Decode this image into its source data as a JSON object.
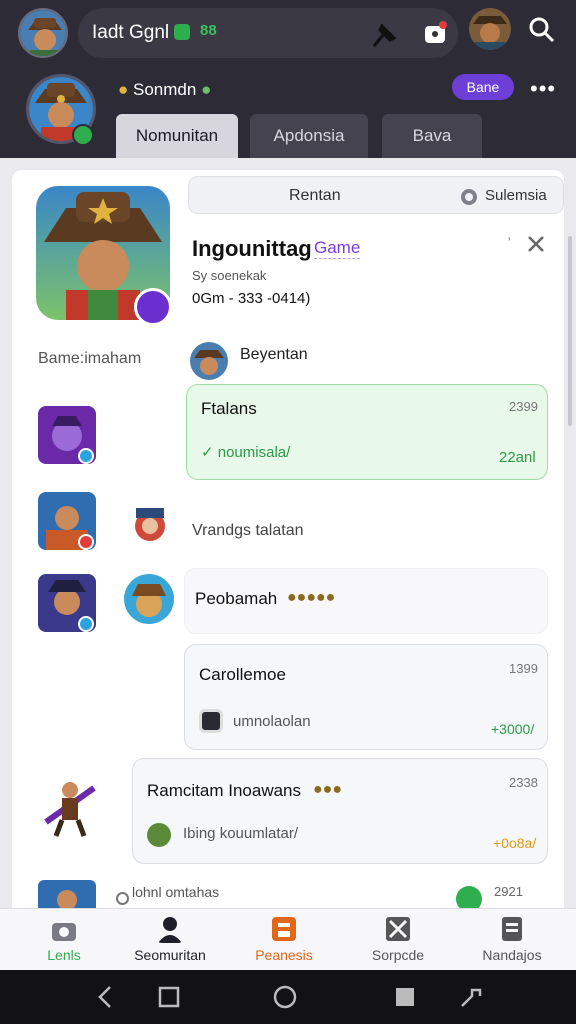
{
  "topbar": {
    "title": "Iadt Ggnl",
    "green_text": "88",
    "icons": [
      "avatar",
      "pin-icon",
      "gift-icon",
      "avatar",
      "search-icon"
    ]
  },
  "profile": {
    "name": "Sonmdn",
    "badge_label": "Bane",
    "more_label": "•••"
  },
  "tabs": [
    {
      "label": "Nomunitan",
      "active": true
    },
    {
      "label": "Apdonsia",
      "active": false
    },
    {
      "label": "Bava",
      "active": false
    }
  ],
  "filter": {
    "label": "Rentan",
    "right_label": "Sulemsia"
  },
  "game": {
    "title": "Ingounittag",
    "tag": "Game",
    "subtitle": "Sy soenekak",
    "phone": "0Gm - 333 -0414)",
    "mark": "'"
  },
  "sidebar": {
    "label": "Bame:imaham"
  },
  "owner": {
    "name": "Beyentan"
  },
  "messages": [
    {
      "title": "Ftalans",
      "time": "2399",
      "sub": "noumisala/",
      "amount": "22anl"
    },
    {
      "text": "Vrandgs talatan"
    },
    {
      "text": "Peobamah",
      "emojis": "●●●●●"
    },
    {
      "title": "Carollemoe",
      "time": "1399",
      "sub": "umnolaolan",
      "amount": "+3000/"
    },
    {
      "title": "Ramcitam Inoawans",
      "time": "2338",
      "sub": "Ibing kouumlatar/",
      "amount": "+0o8a/"
    }
  ],
  "peek": {
    "text": "lohnl omtahas",
    "time": "2921"
  },
  "bottomnav": [
    {
      "label": "Lenls",
      "color": "#2fae4f"
    },
    {
      "label": "Seomuritan",
      "color": "#1f1f29"
    },
    {
      "label": "Peanesis",
      "color": "#e0661a"
    },
    {
      "label": "Sorpcde",
      "color": "#555555"
    },
    {
      "label": "Nandajos",
      "color": "#555555"
    }
  ]
}
